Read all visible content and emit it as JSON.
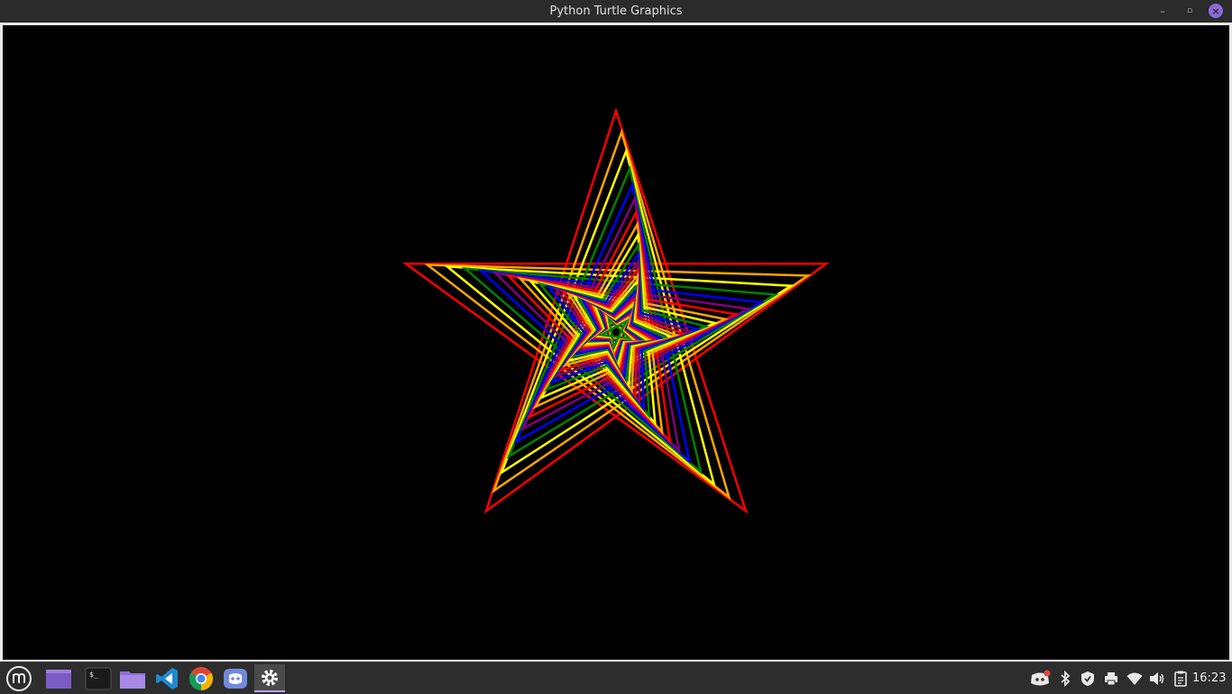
{
  "window": {
    "title": "Python Turtle Graphics",
    "controls": {
      "minimize": "–",
      "maximize": "▫",
      "close": "×"
    }
  },
  "canvas": {
    "background": "#000000",
    "drawing": "star",
    "pen_colors": [
      "#ff0000",
      "#ffa500",
      "#ffff00",
      "#008000",
      "#0000ff",
      "#800080"
    ]
  },
  "taskbar": {
    "menu_icon": "linux-mint-menu-icon",
    "apps": [
      {
        "name": "show-desktop",
        "icon": "purple-folder-icon"
      },
      {
        "name": "terminal",
        "icon": "terminal-icon",
        "label": "$_"
      },
      {
        "name": "files",
        "icon": "folder-icon"
      },
      {
        "name": "vscode",
        "icon": "vscode-icon"
      },
      {
        "name": "chrome",
        "icon": "chrome-icon"
      },
      {
        "name": "discord",
        "icon": "discord-icon"
      },
      {
        "name": "python-turtle",
        "icon": "gear-icon",
        "active": true
      }
    ],
    "tray": [
      "discord-tray-icon",
      "bluetooth-icon",
      "shield-icon",
      "printer-icon",
      "wifi-icon",
      "volume-icon",
      "clipboard-icon"
    ],
    "clock": "16:23"
  }
}
